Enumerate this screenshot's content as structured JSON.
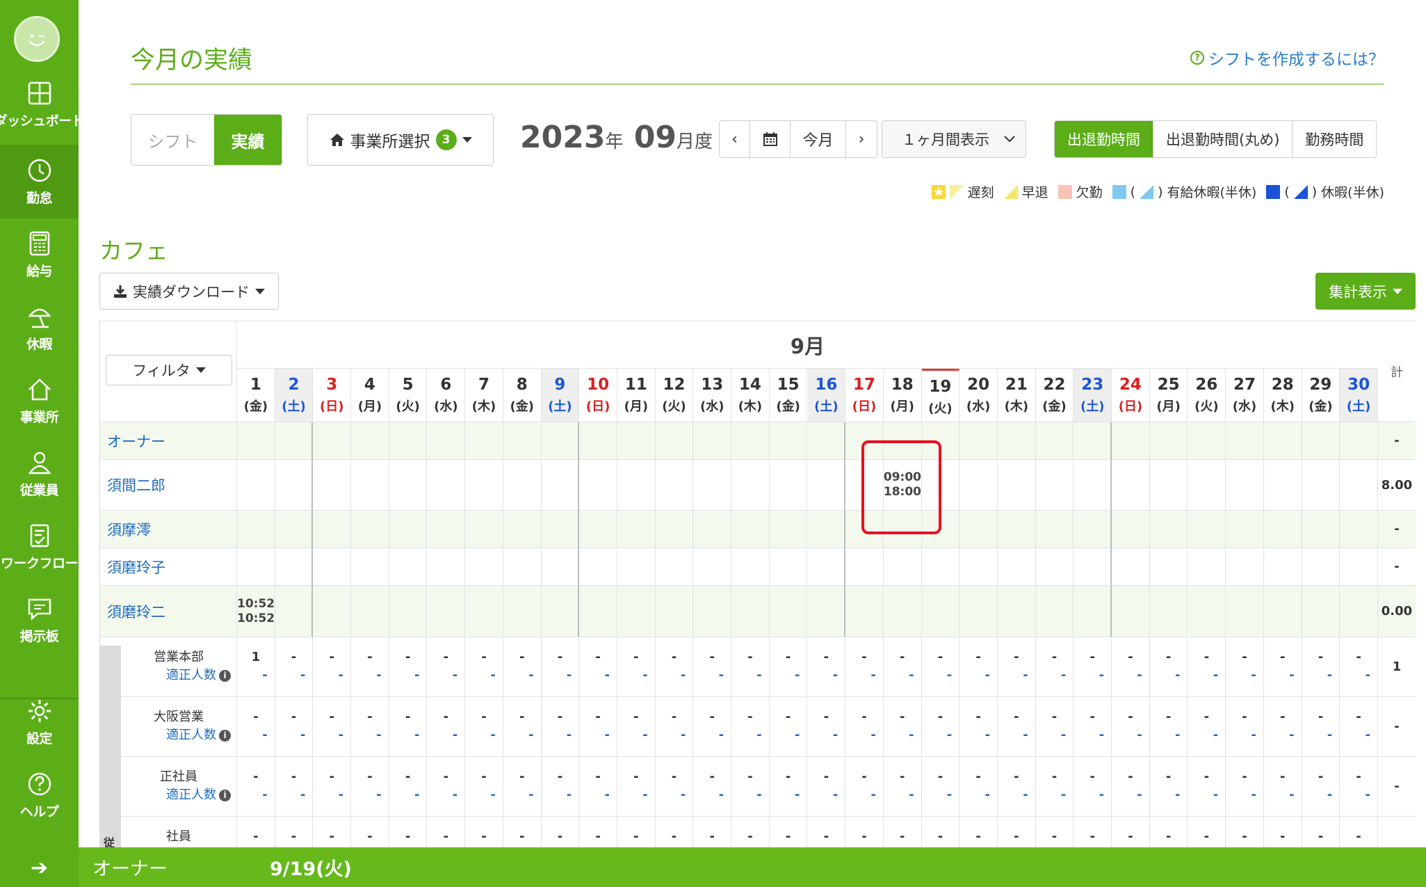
{
  "sidebar": {
    "items": [
      {
        "label": "ダッシュボード",
        "icon": "dashboard-icon"
      },
      {
        "label": "勤怠",
        "icon": "clock-icon"
      },
      {
        "label": "給与",
        "icon": "calculator-icon"
      },
      {
        "label": "休暇",
        "icon": "beach-umbrella-icon"
      },
      {
        "label": "事業所",
        "icon": "home-icon"
      },
      {
        "label": "従業員",
        "icon": "person-icon"
      },
      {
        "label": "ワークフロー",
        "icon": "clipboard-check-icon"
      },
      {
        "label": "掲示板",
        "icon": "chat-icon"
      },
      {
        "label": "設定",
        "icon": "gear-icon"
      },
      {
        "label": "ヘルプ",
        "icon": "help-icon"
      }
    ],
    "collapse": "➔"
  },
  "header": {
    "title": "今月の実績",
    "help_link": "シフトを作成するには？",
    "help_glyph": "?"
  },
  "toolbar": {
    "view_shift": "シフト",
    "view_actual": "実績",
    "office_select": "事業所選択",
    "office_count": "3",
    "year": "2023",
    "year_unit": "年",
    "month": "09",
    "month_unit": "月度",
    "prev": "‹",
    "next": "›",
    "today": "今月",
    "range": "１ヶ月間表示",
    "modes": [
      "出退勤時間",
      "出退勤時間(丸め)",
      "勤務時間"
    ]
  },
  "legend": {
    "late": "遅刻",
    "early": "早退",
    "absent": "欠勤",
    "paid_leave": "有給休暇(半休)",
    "leave": "休暇(半休)",
    "paren_open": "(",
    "paren_close": ")"
  },
  "section": {
    "title": "カフェ",
    "download": "実績ダウンロード",
    "summary": "集計表示"
  },
  "table": {
    "filter": "フィルタ",
    "month": "9月",
    "total_header": "計",
    "days": [
      {
        "d": "1",
        "w": "(金)"
      },
      {
        "d": "2",
        "w": "(土)"
      },
      {
        "d": "3",
        "w": "(日)"
      },
      {
        "d": "4",
        "w": "(月)"
      },
      {
        "d": "5",
        "w": "(火)"
      },
      {
        "d": "6",
        "w": "(水)"
      },
      {
        "d": "7",
        "w": "(木)"
      },
      {
        "d": "8",
        "w": "(金)"
      },
      {
        "d": "9",
        "w": "(土)"
      },
      {
        "d": "10",
        "w": "(日)"
      },
      {
        "d": "11",
        "w": "(月)"
      },
      {
        "d": "12",
        "w": "(火)"
      },
      {
        "d": "13",
        "w": "(水)"
      },
      {
        "d": "14",
        "w": "(木)"
      },
      {
        "d": "15",
        "w": "(金)"
      },
      {
        "d": "16",
        "w": "(土)"
      },
      {
        "d": "17",
        "w": "(日)"
      },
      {
        "d": "18",
        "w": "(月)"
      },
      {
        "d": "19",
        "w": "(火)"
      },
      {
        "d": "20",
        "w": "(水)"
      },
      {
        "d": "21",
        "w": "(木)"
      },
      {
        "d": "22",
        "w": "(金)"
      },
      {
        "d": "23",
        "w": "(土)"
      },
      {
        "d": "24",
        "w": "(日)"
      },
      {
        "d": "25",
        "w": "(月)"
      },
      {
        "d": "26",
        "w": "(火)"
      },
      {
        "d": "27",
        "w": "(水)"
      },
      {
        "d": "28",
        "w": "(木)"
      },
      {
        "d": "29",
        "w": "(金)"
      },
      {
        "d": "30",
        "w": "(土)"
      }
    ],
    "employees": [
      {
        "name": "オーナー",
        "total": "-",
        "shifts": []
      },
      {
        "name": "須間二郎",
        "total": "8.00",
        "shifts": [
          {
            "day": 18,
            "start": "09:00",
            "end": "18:00"
          }
        ]
      },
      {
        "name": "須摩澪",
        "total": "-",
        "shifts": []
      },
      {
        "name": "須磨玲子",
        "total": "-",
        "shifts": []
      },
      {
        "name": "須磨玲二",
        "total": "0.00",
        "shifts": [
          {
            "day": 1,
            "start": "10:52",
            "end": "10:52"
          }
        ]
      }
    ],
    "departments": [
      {
        "name": "営業本部",
        "sub": "適正人数",
        "first_top": "1",
        "total": "1"
      },
      {
        "name": "大阪営業",
        "sub": "適正人数",
        "first_top": "-",
        "total": "-"
      },
      {
        "name": "正社員",
        "sub": "適正人数",
        "first_top": "-",
        "total": "-"
      },
      {
        "name": "社員",
        "sub": "",
        "first_top": "-",
        "total": ""
      }
    ],
    "dash": "-",
    "info_glyph": "i",
    "group_label": "従"
  },
  "bottom": {
    "employee": "オーナー",
    "date": "9/19(火)"
  }
}
